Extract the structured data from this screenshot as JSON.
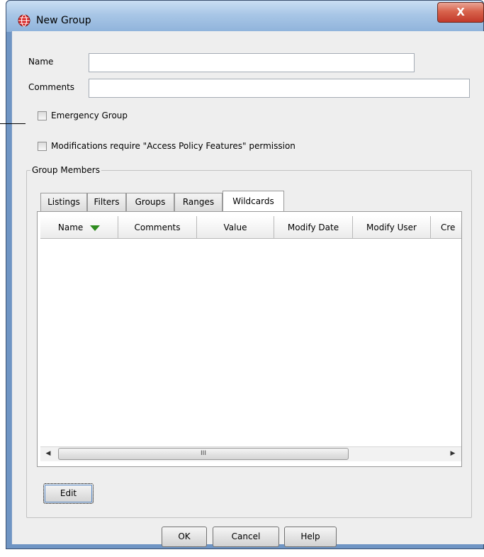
{
  "window": {
    "title": "New Group",
    "close_glyph": "X",
    "app_icon": "globe-icon"
  },
  "form": {
    "name_label": "Name",
    "name_value": "",
    "comments_label": "Comments",
    "comments_value": "",
    "emergency_label": "Emergency Group",
    "emergency_checked": false,
    "modifications_label": "Modifications require \"Access Policy Features\" permission",
    "modifications_checked": false
  },
  "group_members": {
    "legend": "Group Members",
    "tabs": [
      {
        "label": "Listings",
        "active": false
      },
      {
        "label": "Filters",
        "active": false
      },
      {
        "label": "Groups",
        "active": false
      },
      {
        "label": "Ranges",
        "active": false
      },
      {
        "label": "Wildcards",
        "active": true
      }
    ],
    "columns": [
      "Name",
      "Comments",
      "Value",
      "Modify Date",
      "Modify User",
      "Cre"
    ],
    "sort_icon": "sort-descending-icon",
    "sort_color": "#2e8b1e",
    "rows": [],
    "scroll_grip": "III",
    "edit_label": "Edit"
  },
  "buttons": {
    "ok": "OK",
    "cancel": "Cancel",
    "help": "Help"
  }
}
